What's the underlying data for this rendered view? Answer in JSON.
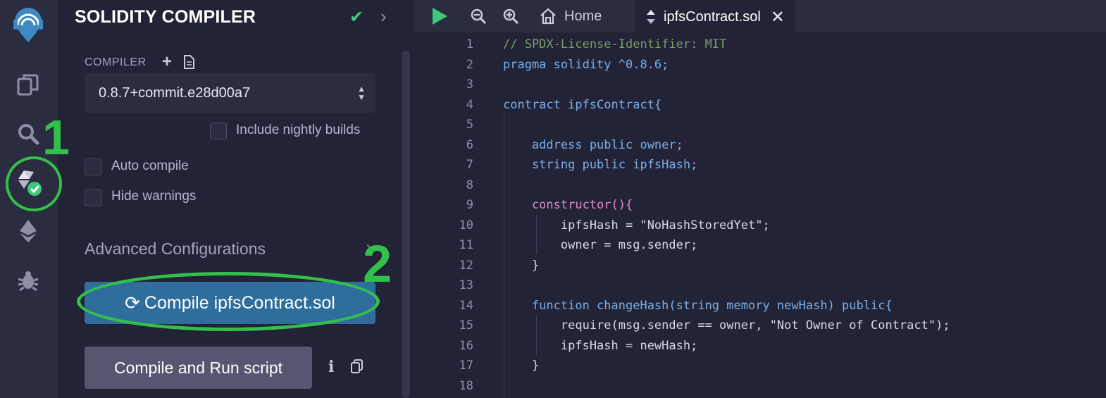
{
  "panel": {
    "title": "SOLIDITY COMPILER",
    "compiler_label": "COMPILER",
    "compiler_version": "0.8.7+commit.e28d00a7",
    "include_nightly_label": "Include nightly builds",
    "auto_compile_label": "Auto compile",
    "hide_warnings_label": "Hide warnings",
    "advanced_label": "Advanced Configurations",
    "compile_button_label": "Compile ipfsContract.sol",
    "run_button_label": "Compile and Run script"
  },
  "annotations": {
    "one": "1",
    "two": "2"
  },
  "editor": {
    "home_tab": "Home",
    "file_tab": "ipfsContract.sol",
    "line_numbers": [
      "1",
      "2",
      "3",
      "4",
      "5",
      "6",
      "7",
      "8",
      "9",
      "10",
      "11",
      "12",
      "13",
      "14",
      "15",
      "16",
      "17",
      "18"
    ],
    "lines": [
      "// SPDX-License-Identifier: MIT",
      "pragma solidity ^0.8.6;",
      "",
      "contract ipfsContract{",
      "",
      "    address public owner;",
      "    string public ipfsHash;",
      "",
      "    constructor(){",
      "        ipfsHash = \"NoHashStoredYet\";",
      "        owner = msg.sender;",
      "    }",
      "",
      "    function changeHash(string memory newHash) public{",
      "        require(msg.sender == owner, \"Not Owner of Contract\");",
      "        ipfsHash = newHash;",
      "    }",
      ""
    ]
  },
  "colors": {
    "accent_green": "#33c04a",
    "compile_button": "#2f6e9c",
    "run_button": "#555770"
  }
}
